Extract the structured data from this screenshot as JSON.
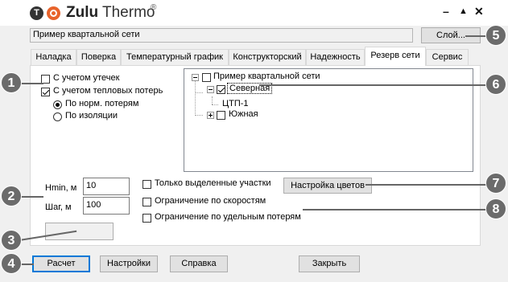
{
  "window": {
    "brand_bold": "Zulu",
    "brand_light": "Thermo",
    "brand_reg": "®",
    "minimize": "–",
    "maximize": "▲",
    "close": "✕"
  },
  "network_name": "Пример квартальной сети",
  "layer_button": "Слой...",
  "tabs": [
    {
      "label": "Наладка"
    },
    {
      "label": "Поверка"
    },
    {
      "label": "Температурный график"
    },
    {
      "label": "Конструкторский"
    },
    {
      "label": "Надежность"
    },
    {
      "label": "Резерв сети",
      "active": true
    },
    {
      "label": "Сервис"
    }
  ],
  "options": {
    "leaks": {
      "label": "С учетом утечек",
      "checked": false
    },
    "heat_loss": {
      "label": "С учетом тепловых потерь",
      "checked": true
    },
    "by_norm": {
      "label": "По норм. потерям",
      "checked": true
    },
    "by_insulation": {
      "label": "По изоляции",
      "checked": false
    }
  },
  "tree": {
    "root": "Пример квартальной сети",
    "north": "Северная",
    "ctp": "ЦТП-1",
    "south": "Южная"
  },
  "params": {
    "hmin_label": "Hmin, м",
    "hmin_value": "10",
    "step_label": "Шаг, м",
    "step_value": "100"
  },
  "filters": {
    "selected_only": {
      "label": "Только выделенные участки",
      "checked": false
    },
    "speed_limit": {
      "label": "Ограничение по скоростям",
      "checked": false
    },
    "loss_limit": {
      "label": "Ограничение по удельным потерям",
      "checked": false
    }
  },
  "color_settings_button": "Настройка цветов",
  "bottom_buttons": {
    "calc": "Расчет",
    "settings": "Настройки",
    "help": "Справка",
    "close": "Закрыть"
  },
  "callouts": [
    "1",
    "2",
    "3",
    "4",
    "5",
    "6",
    "7",
    "8"
  ],
  "colors": {
    "accent": "#0078d7",
    "callout": "#6b6b6b",
    "logo_orange": "#e8632b"
  }
}
